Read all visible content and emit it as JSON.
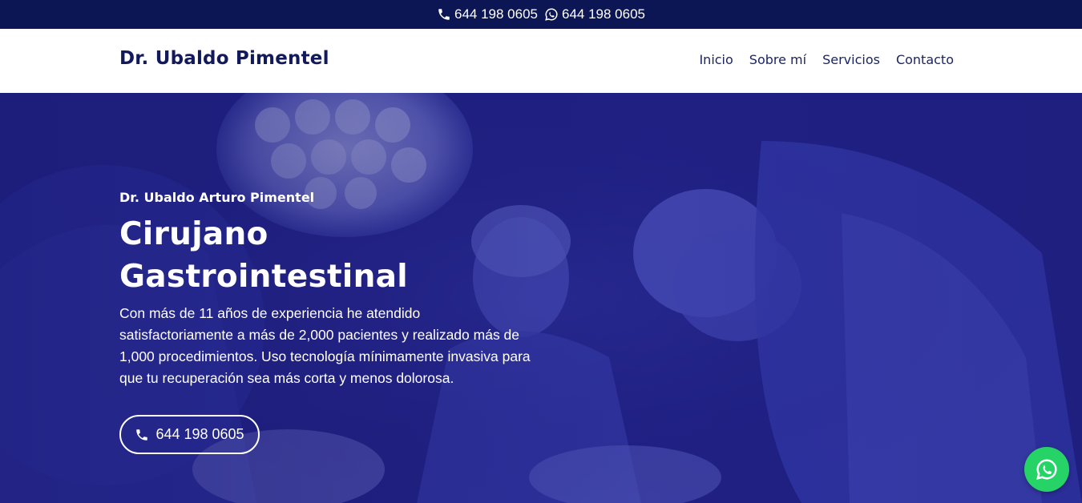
{
  "topbar": {
    "phone": "644 198 0605",
    "whatsapp": "644 198 0605",
    "phone_icon": "phone-icon",
    "whatsapp_icon": "whatsapp-icon"
  },
  "header": {
    "brand": "Dr. Ubaldo Pimentel",
    "nav": [
      {
        "label": "Inicio"
      },
      {
        "label": "Sobre mí"
      },
      {
        "label": "Servicios"
      },
      {
        "label": "Contacto"
      }
    ]
  },
  "hero": {
    "subtitle": "Dr. Ubaldo Arturo Pimentel",
    "title_line1": "Cirujano",
    "title_line2": "Gastrointestinal",
    "description": "Con más de 11 años de experiencia he atendido satisfactoriamente a más de 2,000 pacientes y realizado más de 1,000 procedimientos. Uso tecnología mínimamente invasiva para que tu recuperación sea más corta y menos dolorosa.",
    "cta_label": "644 198 0605",
    "cta_icon": "phone-icon"
  },
  "floating": {
    "icon": "whatsapp-icon"
  },
  "colors": {
    "topbar": "#0c1654",
    "brand_text": "#131a5c",
    "hero_overlay": "#23238a",
    "whatsapp_green": "#25d366"
  }
}
